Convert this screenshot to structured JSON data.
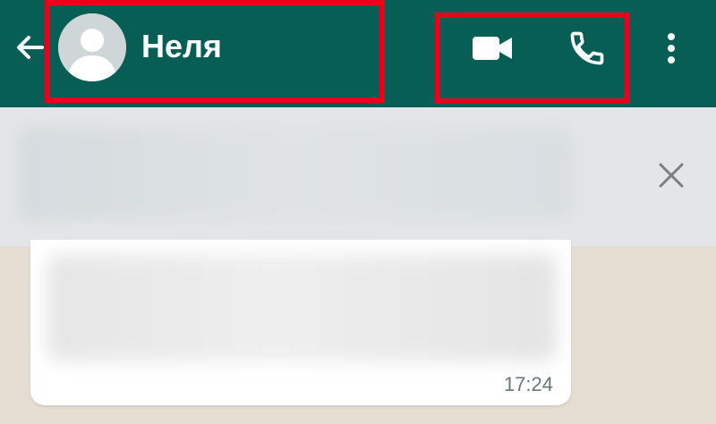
{
  "app_bar": {
    "contact_name": "Неля",
    "background_color": "#075e54",
    "highlight_color": "#e8001c",
    "back_icon": "arrow-left-icon",
    "avatar_icon": "default-avatar-icon",
    "video_icon": "video-camera-icon",
    "call_icon": "phone-icon",
    "menu_icon": "more-vertical-icon"
  },
  "banner": {
    "close_icon": "close-icon"
  },
  "message": {
    "time": "17:24"
  }
}
